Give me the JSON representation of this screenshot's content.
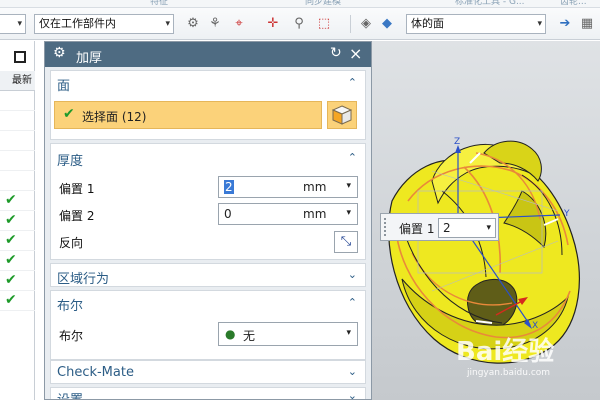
{
  "toolbar": {
    "scope_filter": "仅在工作部件内",
    "face_rule": "体的面"
  },
  "left_panel": {
    "column_header": "最新",
    "checked_rows": 6
  },
  "dialog": {
    "title": "加厚",
    "sections": {
      "face": {
        "header": "面",
        "select_label": "选择面 (12)"
      },
      "thickness": {
        "header": "厚度",
        "offset1_label": "偏置 1",
        "offset1_value": "2",
        "offset1_unit": "mm",
        "offset2_label": "偏置 2",
        "offset2_value": "0",
        "offset2_unit": "mm",
        "reverse_label": "反向"
      },
      "region": {
        "header": "区域行为"
      },
      "boolean": {
        "header": "布尔",
        "label": "布尔",
        "value": "无"
      },
      "checkmate": {
        "header": "Check-Mate"
      },
      "settings": {
        "header": "设置"
      }
    }
  },
  "viewport": {
    "tooltip_label": "偏置 1",
    "tooltip_value": "2",
    "axis_z": "Z",
    "axis_y": "Y",
    "axis_x": "X",
    "watermark": "Bai经验",
    "watermark_sub": "jingyan.baidu.com"
  },
  "colors": {
    "title_bar": "#4e6b82",
    "section_header": "#2c5d86",
    "highlight": "#fbd27a",
    "model_yellow": "#f0ec1e",
    "check_green": "#1e9a2a"
  }
}
